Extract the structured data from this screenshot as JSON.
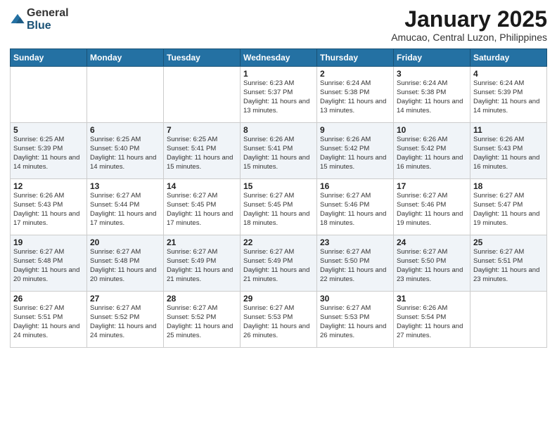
{
  "logo": {
    "general": "General",
    "blue": "Blue"
  },
  "header": {
    "title": "January 2025",
    "location": "Amucao, Central Luzon, Philippines"
  },
  "days_of_week": [
    "Sunday",
    "Monday",
    "Tuesday",
    "Wednesday",
    "Thursday",
    "Friday",
    "Saturday"
  ],
  "weeks": [
    [
      {
        "day": "",
        "info": ""
      },
      {
        "day": "",
        "info": ""
      },
      {
        "day": "",
        "info": ""
      },
      {
        "day": "1",
        "info": "Sunrise: 6:23 AM\nSunset: 5:37 PM\nDaylight: 11 hours and 13 minutes."
      },
      {
        "day": "2",
        "info": "Sunrise: 6:24 AM\nSunset: 5:38 PM\nDaylight: 11 hours and 13 minutes."
      },
      {
        "day": "3",
        "info": "Sunrise: 6:24 AM\nSunset: 5:38 PM\nDaylight: 11 hours and 14 minutes."
      },
      {
        "day": "4",
        "info": "Sunrise: 6:24 AM\nSunset: 5:39 PM\nDaylight: 11 hours and 14 minutes."
      }
    ],
    [
      {
        "day": "5",
        "info": "Sunrise: 6:25 AM\nSunset: 5:39 PM\nDaylight: 11 hours and 14 minutes."
      },
      {
        "day": "6",
        "info": "Sunrise: 6:25 AM\nSunset: 5:40 PM\nDaylight: 11 hours and 14 minutes."
      },
      {
        "day": "7",
        "info": "Sunrise: 6:25 AM\nSunset: 5:41 PM\nDaylight: 11 hours and 15 minutes."
      },
      {
        "day": "8",
        "info": "Sunrise: 6:26 AM\nSunset: 5:41 PM\nDaylight: 11 hours and 15 minutes."
      },
      {
        "day": "9",
        "info": "Sunrise: 6:26 AM\nSunset: 5:42 PM\nDaylight: 11 hours and 15 minutes."
      },
      {
        "day": "10",
        "info": "Sunrise: 6:26 AM\nSunset: 5:42 PM\nDaylight: 11 hours and 16 minutes."
      },
      {
        "day": "11",
        "info": "Sunrise: 6:26 AM\nSunset: 5:43 PM\nDaylight: 11 hours and 16 minutes."
      }
    ],
    [
      {
        "day": "12",
        "info": "Sunrise: 6:26 AM\nSunset: 5:43 PM\nDaylight: 11 hours and 17 minutes."
      },
      {
        "day": "13",
        "info": "Sunrise: 6:27 AM\nSunset: 5:44 PM\nDaylight: 11 hours and 17 minutes."
      },
      {
        "day": "14",
        "info": "Sunrise: 6:27 AM\nSunset: 5:45 PM\nDaylight: 11 hours and 17 minutes."
      },
      {
        "day": "15",
        "info": "Sunrise: 6:27 AM\nSunset: 5:45 PM\nDaylight: 11 hours and 18 minutes."
      },
      {
        "day": "16",
        "info": "Sunrise: 6:27 AM\nSunset: 5:46 PM\nDaylight: 11 hours and 18 minutes."
      },
      {
        "day": "17",
        "info": "Sunrise: 6:27 AM\nSunset: 5:46 PM\nDaylight: 11 hours and 19 minutes."
      },
      {
        "day": "18",
        "info": "Sunrise: 6:27 AM\nSunset: 5:47 PM\nDaylight: 11 hours and 19 minutes."
      }
    ],
    [
      {
        "day": "19",
        "info": "Sunrise: 6:27 AM\nSunset: 5:48 PM\nDaylight: 11 hours and 20 minutes."
      },
      {
        "day": "20",
        "info": "Sunrise: 6:27 AM\nSunset: 5:48 PM\nDaylight: 11 hours and 20 minutes."
      },
      {
        "day": "21",
        "info": "Sunrise: 6:27 AM\nSunset: 5:49 PM\nDaylight: 11 hours and 21 minutes."
      },
      {
        "day": "22",
        "info": "Sunrise: 6:27 AM\nSunset: 5:49 PM\nDaylight: 11 hours and 21 minutes."
      },
      {
        "day": "23",
        "info": "Sunrise: 6:27 AM\nSunset: 5:50 PM\nDaylight: 11 hours and 22 minutes."
      },
      {
        "day": "24",
        "info": "Sunrise: 6:27 AM\nSunset: 5:50 PM\nDaylight: 11 hours and 23 minutes."
      },
      {
        "day": "25",
        "info": "Sunrise: 6:27 AM\nSunset: 5:51 PM\nDaylight: 11 hours and 23 minutes."
      }
    ],
    [
      {
        "day": "26",
        "info": "Sunrise: 6:27 AM\nSunset: 5:51 PM\nDaylight: 11 hours and 24 minutes."
      },
      {
        "day": "27",
        "info": "Sunrise: 6:27 AM\nSunset: 5:52 PM\nDaylight: 11 hours and 24 minutes."
      },
      {
        "day": "28",
        "info": "Sunrise: 6:27 AM\nSunset: 5:52 PM\nDaylight: 11 hours and 25 minutes."
      },
      {
        "day": "29",
        "info": "Sunrise: 6:27 AM\nSunset: 5:53 PM\nDaylight: 11 hours and 26 minutes."
      },
      {
        "day": "30",
        "info": "Sunrise: 6:27 AM\nSunset: 5:53 PM\nDaylight: 11 hours and 26 minutes."
      },
      {
        "day": "31",
        "info": "Sunrise: 6:26 AM\nSunset: 5:54 PM\nDaylight: 11 hours and 27 minutes."
      },
      {
        "day": "",
        "info": ""
      }
    ]
  ]
}
